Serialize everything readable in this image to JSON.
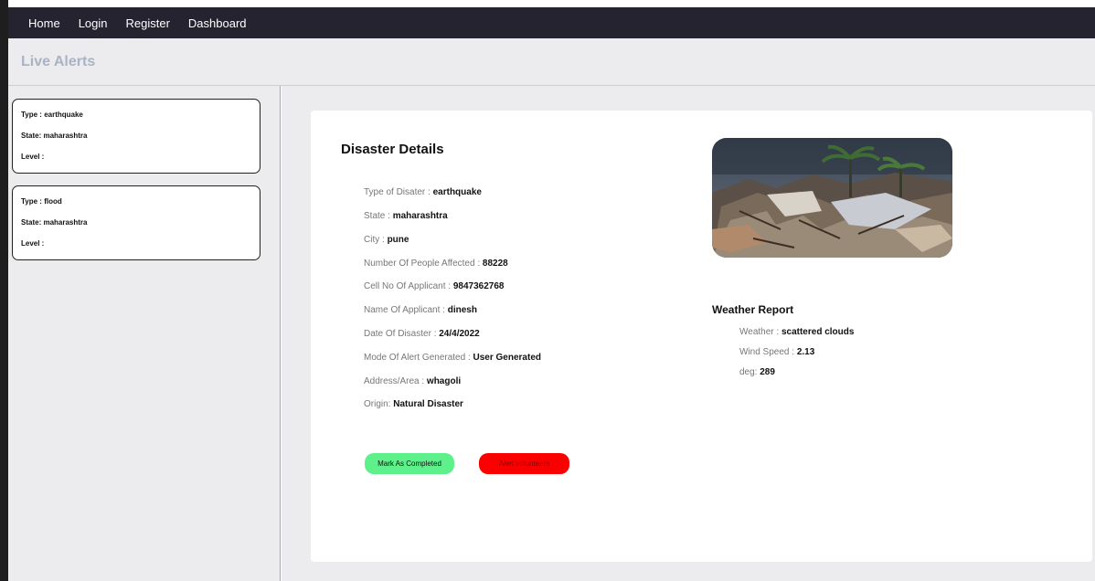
{
  "nav": {
    "items": [
      {
        "label": "Home"
      },
      {
        "label": "Login"
      },
      {
        "label": "Register"
      },
      {
        "label": "Dashboard"
      }
    ]
  },
  "alerts_header": {
    "title": "Live Alerts"
  },
  "alerts": [
    {
      "type": "Type : earthquake",
      "state": "State: maharashtra",
      "level": "Level :"
    },
    {
      "type": "Type : flood",
      "state": "State: maharashtra",
      "level": "Level :"
    }
  ],
  "details": {
    "title": "Disaster Details",
    "rows": [
      {
        "label": "Type of Disater : ",
        "value": "earthquake"
      },
      {
        "label": "State : ",
        "value": "maharashtra"
      },
      {
        "label": "City : ",
        "value": "pune"
      },
      {
        "label": "Number Of People Affected : ",
        "value": "88228"
      },
      {
        "label": "Cell No Of Applicant : ",
        "value": "9847362768"
      },
      {
        "label": "Name Of Applicant : ",
        "value": "dinesh"
      },
      {
        "label": "Date Of Disaster : ",
        "value": "24/4/2022"
      },
      {
        "label": "Mode Of Alert Generated : ",
        "value": "User Generated"
      },
      {
        "label": "Address/Area : ",
        "value": "whagoli"
      },
      {
        "label": "Origin: ",
        "value": "Natural Disaster"
      }
    ]
  },
  "weather": {
    "title": "Weather Report",
    "rows": [
      {
        "label": "Weather : ",
        "value": "scattered clouds"
      },
      {
        "label": "Wind Speed : ",
        "value": "2.13"
      },
      {
        "label": "deg: ",
        "value": "289"
      }
    ]
  },
  "actions": {
    "complete_label": "Mark As Completed",
    "alert_label": "Alert volunteers"
  },
  "colors": {
    "navbar": "#24232f",
    "complete_button": "#5ef08a",
    "alert_button": "#fb0000",
    "header_text": "#aab2c6"
  }
}
